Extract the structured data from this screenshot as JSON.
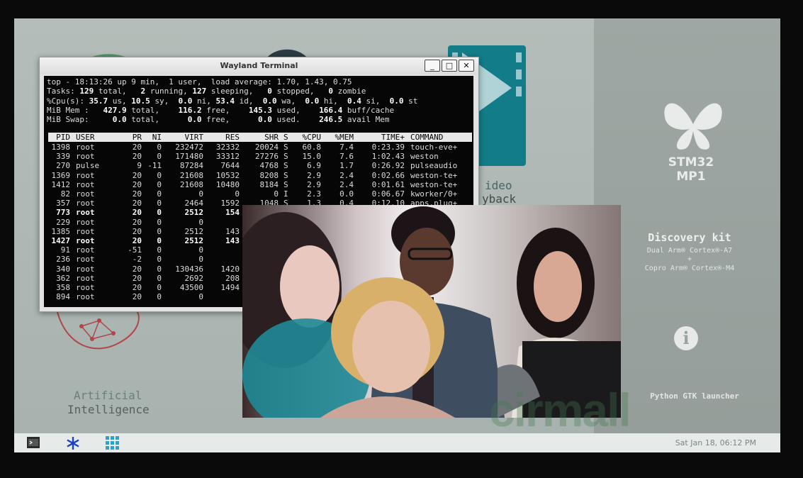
{
  "terminal": {
    "title": "Wayland Terminal",
    "buttons": {
      "minimize": "_",
      "maximize": "□",
      "close": "✕"
    },
    "summary": [
      [
        {
          "t": "top - 18:13:26 up 9 min,  1 user,  load average: 1.70, 1.43, 0.75",
          "b": false
        }
      ],
      [
        {
          "t": "Tasks: ",
          "b": false
        },
        {
          "t": "129",
          "b": true
        },
        {
          "t": " total,   ",
          "b": false
        },
        {
          "t": "2",
          "b": true
        },
        {
          "t": " running, ",
          "b": false
        },
        {
          "t": "127",
          "b": true
        },
        {
          "t": " sleeping,   ",
          "b": false
        },
        {
          "t": "0",
          "b": true
        },
        {
          "t": " stopped,   ",
          "b": false
        },
        {
          "t": "0",
          "b": true
        },
        {
          "t": " zombie",
          "b": false
        }
      ],
      [
        {
          "t": "%Cpu(s): ",
          "b": false
        },
        {
          "t": "35.7",
          "b": true
        },
        {
          "t": " us, ",
          "b": false
        },
        {
          "t": "10.5",
          "b": true
        },
        {
          "t": " sy,  ",
          "b": false
        },
        {
          "t": "0.0",
          "b": true
        },
        {
          "t": " ni, ",
          "b": false
        },
        {
          "t": "53.4",
          "b": true
        },
        {
          "t": " id,  ",
          "b": false
        },
        {
          "t": "0.0",
          "b": true
        },
        {
          "t": " wa,  ",
          "b": false
        },
        {
          "t": "0.0",
          "b": true
        },
        {
          "t": " hi,  ",
          "b": false
        },
        {
          "t": "0.4",
          "b": true
        },
        {
          "t": " si,  ",
          "b": false
        },
        {
          "t": "0.0",
          "b": true
        },
        {
          "t": " st",
          "b": false
        }
      ],
      [
        {
          "t": "MiB Mem :   ",
          "b": false
        },
        {
          "t": "427.9",
          "b": true
        },
        {
          "t": " total,    ",
          "b": false
        },
        {
          "t": "116.2",
          "b": true
        },
        {
          "t": " free,    ",
          "b": false
        },
        {
          "t": "145.3",
          "b": true
        },
        {
          "t": " used,    ",
          "b": false
        },
        {
          "t": "166.4",
          "b": true
        },
        {
          "t": " buff/cache",
          "b": false
        }
      ],
      [
        {
          "t": "MiB Swap:     ",
          "b": false
        },
        {
          "t": "0.0",
          "b": true
        },
        {
          "t": " total,      ",
          "b": false
        },
        {
          "t": "0.0",
          "b": true
        },
        {
          "t": " free,      ",
          "b": false
        },
        {
          "t": "0.0",
          "b": true
        },
        {
          "t": " used.    ",
          "b": false
        },
        {
          "t": "246.5",
          "b": true
        },
        {
          "t": " avail Mem",
          "b": false
        }
      ]
    ],
    "columns": [
      "PID",
      "USER",
      "PR",
      "NI",
      "VIRT",
      "RES",
      "SHR",
      "S",
      "%CPU",
      "%MEM",
      "TIME+",
      "COMMAND"
    ],
    "processes": [
      {
        "pid": "1398",
        "user": "root",
        "pr": "20",
        "ni": "0",
        "virt": "232472",
        "res": "32332",
        "shr": "20024",
        "s": "S",
        "cpu": "60.8",
        "mem": "7.4",
        "time": "0:23.39",
        "cmd": "touch-eve+",
        "bold": false
      },
      {
        "pid": "339",
        "user": "root",
        "pr": "20",
        "ni": "0",
        "virt": "171480",
        "res": "33312",
        "shr": "27276",
        "s": "S",
        "cpu": "15.0",
        "mem": "7.6",
        "time": "1:02.43",
        "cmd": "weston",
        "bold": false
      },
      {
        "pid": "270",
        "user": "pulse",
        "pr": "9",
        "ni": "-11",
        "virt": "87284",
        "res": "7644",
        "shr": "4768",
        "s": "S",
        "cpu": "6.9",
        "mem": "1.7",
        "time": "0:26.92",
        "cmd": "pulseaudio",
        "bold": false
      },
      {
        "pid": "1369",
        "user": "root",
        "pr": "20",
        "ni": "0",
        "virt": "21608",
        "res": "10532",
        "shr": "8208",
        "s": "S",
        "cpu": "2.9",
        "mem": "2.4",
        "time": "0:02.66",
        "cmd": "weston-te+",
        "bold": false
      },
      {
        "pid": "1412",
        "user": "root",
        "pr": "20",
        "ni": "0",
        "virt": "21608",
        "res": "10480",
        "shr": "8184",
        "s": "S",
        "cpu": "2.9",
        "mem": "2.4",
        "time": "0:01.61",
        "cmd": "weston-te+",
        "bold": false
      },
      {
        "pid": "82",
        "user": "root",
        "pr": "20",
        "ni": "0",
        "virt": "0",
        "res": "0",
        "shr": "0",
        "s": "I",
        "cpu": "2.3",
        "mem": "0.0",
        "time": "0:06.67",
        "cmd": "kworker/0+",
        "bold": false
      },
      {
        "pid": "357",
        "user": "root",
        "pr": "20",
        "ni": "0",
        "virt": "2464",
        "res": "1592",
        "shr": "1048",
        "s": "S",
        "cpu": "1.3",
        "mem": "0.4",
        "time": "0:12.10",
        "cmd": "apps.plug+",
        "bold": false
      },
      {
        "pid": "773",
        "user": "root",
        "pr": "20",
        "ni": "0",
        "virt": "2512",
        "res": "154",
        "shr": "",
        "s": "",
        "cpu": "",
        "mem": "",
        "time": "",
        "cmd": "",
        "bold": true
      },
      {
        "pid": "229",
        "user": "root",
        "pr": "20",
        "ni": "0",
        "virt": "0",
        "res": "",
        "shr": "",
        "s": "",
        "cpu": "",
        "mem": "",
        "time": "",
        "cmd": "",
        "bold": false
      },
      {
        "pid": "1385",
        "user": "root",
        "pr": "20",
        "ni": "0",
        "virt": "2512",
        "res": "143",
        "shr": "",
        "s": "",
        "cpu": "",
        "mem": "",
        "time": "",
        "cmd": "",
        "bold": false
      },
      {
        "pid": "1427",
        "user": "root",
        "pr": "20",
        "ni": "0",
        "virt": "2512",
        "res": "143",
        "shr": "",
        "s": "",
        "cpu": "",
        "mem": "",
        "time": "",
        "cmd": "",
        "bold": true
      },
      {
        "pid": "91",
        "user": "root",
        "pr": "-51",
        "ni": "0",
        "virt": "0",
        "res": "",
        "shr": "",
        "s": "",
        "cpu": "",
        "mem": "",
        "time": "",
        "cmd": "",
        "bold": false
      },
      {
        "pid": "236",
        "user": "root",
        "pr": "-2",
        "ni": "0",
        "virt": "0",
        "res": "",
        "shr": "",
        "s": "",
        "cpu": "",
        "mem": "",
        "time": "",
        "cmd": "",
        "bold": false
      },
      {
        "pid": "340",
        "user": "root",
        "pr": "20",
        "ni": "0",
        "virt": "130436",
        "res": "1420",
        "shr": "",
        "s": "",
        "cpu": "",
        "mem": "",
        "time": "",
        "cmd": "",
        "bold": false
      },
      {
        "pid": "362",
        "user": "root",
        "pr": "20",
        "ni": "0",
        "virt": "2692",
        "res": "208",
        "shr": "",
        "s": "",
        "cpu": "",
        "mem": "",
        "time": "",
        "cmd": "",
        "bold": false
      },
      {
        "pid": "358",
        "user": "root",
        "pr": "20",
        "ni": "0",
        "virt": "43500",
        "res": "1494",
        "shr": "",
        "s": "",
        "cpu": "",
        "mem": "",
        "time": "",
        "cmd": "",
        "bold": false
      },
      {
        "pid": "894",
        "user": "root",
        "pr": "20",
        "ni": "0",
        "virt": "0",
        "res": "",
        "shr": "",
        "s": "",
        "cpu": "",
        "mem": "",
        "time": "",
        "cmd": "",
        "bold": false
      }
    ]
  },
  "desktop": {
    "ai_app": {
      "line1": "Artificial",
      "line2": "Intelligence"
    },
    "video_app": {
      "line1": "ideo",
      "line2": "yback"
    }
  },
  "right_panel": {
    "logo_text": "STM32 MP1",
    "kit_title": "Discovery kit",
    "kit_line1": "Dual Arm® Cortex®-A7",
    "kit_plus": "+",
    "kit_line2": "Copro Arm® Cortex®-M4",
    "info_icon": "i",
    "launcher": "Python GTK launcher"
  },
  "taskbar": {
    "clock": "Sat Jan 18, 06:12 PM",
    "icons": [
      "terminal-icon",
      "asterisk-icon",
      "app-grid-icon"
    ]
  },
  "watermark": "cirmall",
  "colors": {
    "accent_blue": "#1a73c9",
    "video_tile": "#0f7d8a",
    "ai_red": "#b0464a",
    "wallpaper": "#a9b2ae"
  }
}
